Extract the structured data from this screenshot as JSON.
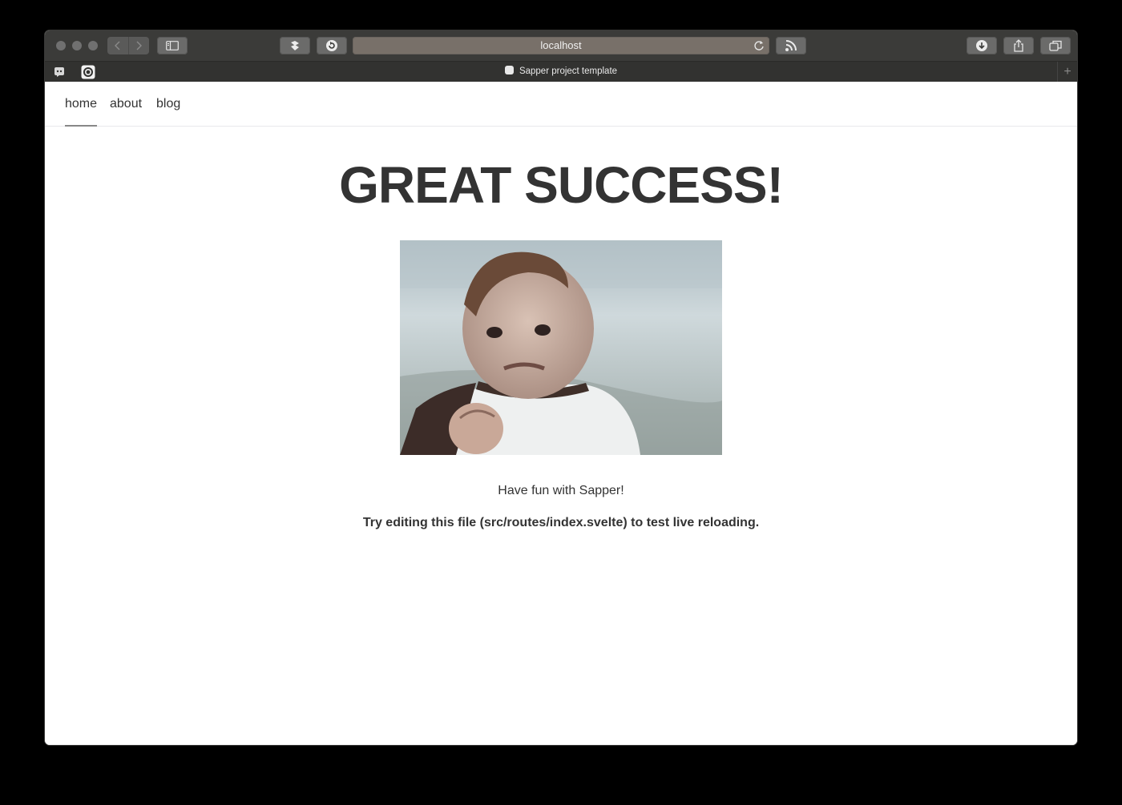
{
  "browser": {
    "url": "localhost",
    "tab_title": "Sapper project template",
    "new_tab_symbol": "+"
  },
  "nav": {
    "items": [
      {
        "label": "home",
        "active": true
      },
      {
        "label": "about",
        "active": false
      },
      {
        "label": "blog",
        "active": false
      }
    ]
  },
  "main": {
    "heading": "GREAT SUCCESS!",
    "image_subject": "success-kid-photo",
    "caption": "Have fun with Sapper!",
    "note": "Try editing this file (src/routes/index.svelte) to test live reloading."
  },
  "colors": {
    "text": "#333333",
    "toolbar": "#3b3b39",
    "address_bar": "#787069",
    "page_background": "#ffffff"
  }
}
